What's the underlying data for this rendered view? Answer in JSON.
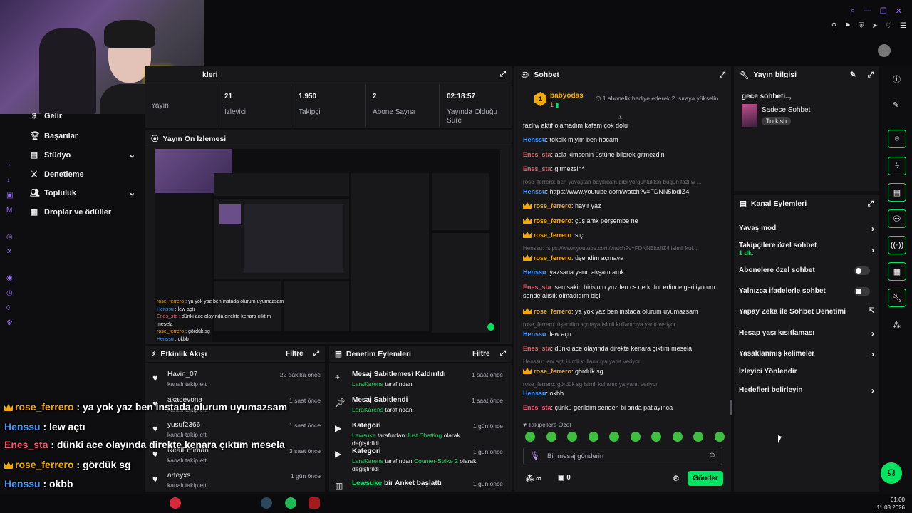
{
  "sidebar": {
    "items": [
      {
        "label": "Gelir",
        "icon": "dollar-icon"
      },
      {
        "label": "Başarılar",
        "icon": "trophy-icon"
      },
      {
        "label": "Stüdyo",
        "icon": "studio-icon",
        "chevron": true
      },
      {
        "label": "Denetleme",
        "icon": "sword-icon"
      },
      {
        "label": "Topluluk",
        "icon": "users-icon",
        "chevron": true
      },
      {
        "label": "Droplar ve ödüller",
        "icon": "gift-icon"
      }
    ]
  },
  "stats": {
    "header_label": "kleri",
    "items": [
      {
        "value": "",
        "label": "Yayın"
      },
      {
        "value": "21",
        "label": "İzleyici"
      },
      {
        "value": "1.950",
        "label": "Takipçi"
      },
      {
        "value": "2",
        "label": "Abone Sayısı"
      },
      {
        "value": "02:18:57",
        "label": "Yayında Olduğu Süre"
      }
    ]
  },
  "preview": {
    "title": "Yayın Ön İzlemesi"
  },
  "activity": {
    "title": "Etkinlik Akışı",
    "filter": "Filtre",
    "items": [
      {
        "name": "Havin_07",
        "sub": "kanalı takip etti",
        "time": "22 dakika önce"
      },
      {
        "name": "akadevona",
        "sub": "kanalı takip etti",
        "time": "1 saat önce"
      },
      {
        "name": "yusuf2366",
        "sub": "kanalı takip etti",
        "time": "1 saat önce"
      },
      {
        "name": "RealEmirhan",
        "sub": "kanalı takip etti",
        "time": "3 saat önce"
      },
      {
        "name": "arteyxs",
        "sub": "kanalı takip etti",
        "time": "1 gün önce"
      }
    ]
  },
  "moderation": {
    "title": "Denetim Eylemleri",
    "filter": "Filtre",
    "items": [
      {
        "title": "Mesaj Sabitlemesi Kaldırıldı",
        "user": "LaraKarens",
        "rest": "tarafından",
        "time": "1 saat önce"
      },
      {
        "title": "Mesaj Sabitlendi",
        "user": "LaraKarens",
        "rest": "tarafından",
        "time": "1 saat önce"
      },
      {
        "title": "Kategori",
        "user": "Lewsuke",
        "rest": "tarafından",
        "cat": "Just Chatting",
        "rest2": "olarak değiştirildi",
        "time": "1 gün önce"
      },
      {
        "title": "Kategori",
        "user": "LaraKarens",
        "rest": "tarafından",
        "cat": "Counter-Strike 2",
        "rest2": "olarak değiştirildi",
        "time": "1 gün önce"
      },
      {
        "title": "bir Anket başlattı",
        "user": "Lewsuke",
        "time": "1 gün önce"
      }
    ]
  },
  "chat": {
    "title": "Sohbet",
    "pinned_user": "babyodas",
    "pinned_count": "1",
    "pinned_text": "1 abonelik hediye ederek 2. sıraya yükselin",
    "followers_only": "Takipçilere Özel",
    "input_placeholder": "Bir mesaj gönderin",
    "send": "Gönder",
    "points": "∞",
    "bits": "0",
    "messages": [
      {
        "user": "",
        "text": "fazlıw aktif olamadım kafam çok dolu",
        "color": "#efeff1"
      },
      {
        "user": "Henssu",
        "text": "toksik miyim ben hocam",
        "color": "#3b9aff"
      },
      {
        "user": "Enes_sta",
        "text": "asla kimsenin üstüne bilerek gitmezdin",
        "color": "#f0576a"
      },
      {
        "user": "Enes_sta",
        "text": "gitmezsin*",
        "color": "#f0576a"
      },
      {
        "reply": "rose_ferrero: ben yavaştan bayılıcam gibi yorguhluktsn bugün fazlıw ..."
      },
      {
        "user": "Henssu",
        "text": "https://www.youtube.com/watch?v=FDNN5lodIZ4",
        "color": "#3b9aff",
        "link": true
      },
      {
        "user": "rose_ferrero",
        "text": "hayır yaz",
        "color": "#f2a80b",
        "crown": true
      },
      {
        "user": "rose_ferrero",
        "text": "çüş amk perşembe ne",
        "color": "#f2a80b",
        "crown": true
      },
      {
        "user": "rose_ferrero",
        "text": "sıç",
        "color": "#f2a80b",
        "crown": true
      },
      {
        "reply": "Henssu: https://www.youtube.com/watch?v=FDNN5lodIZ4 isimli kul..."
      },
      {
        "user": "rose_ferrero",
        "text": "üşendim açmaya",
        "color": "#f2a80b",
        "crown": true
      },
      {
        "user": "Henssu",
        "text": "yazsana yarın akşam amk",
        "color": "#3b9aff"
      },
      {
        "user": "Enes_sta",
        "text": "sen sakin birisin o yuzden cs de kufur edince geriliyorum sende alısık olmadıgım bişi",
        "color": "#f0576a"
      },
      {
        "user": "rose_ferrero",
        "text": "ya yok yaz ben instada olurum uyumazsam",
        "color": "#f2a80b",
        "crown": true
      },
      {
        "reply": "rose_ferrero: üşendim açmaya isimli kullanıcıya yanıt veriyor"
      },
      {
        "user": "Henssu",
        "text": "lew açtı",
        "color": "#3b9aff"
      },
      {
        "user": "Enes_sta",
        "text": "dünki ace olayında direkte kenara çıktım mesela",
        "color": "#f0576a"
      },
      {
        "reply": "Henssu: lew açtı isimli kullanıcıya yanıt veriyor"
      },
      {
        "user": "rose_ferrero",
        "text": "gördük sg",
        "color": "#f2a80b",
        "crown": true
      },
      {
        "reply": "rose_ferrero: gördük sg isimli kullanıcıya yanıt veriyor"
      },
      {
        "user": "Henssu",
        "text": "okbb",
        "color": "#3b9aff"
      },
      {
        "user": "Enes_sta",
        "text": "çünkü gerildim senden bi anda patlayınca",
        "color": "#f0576a"
      }
    ]
  },
  "stream_info": {
    "title": "Yayın bilgisi",
    "stream_title": "gece sohbeti..,",
    "category": "Sadece Sohbet",
    "language": "Turkish"
  },
  "channel_actions": {
    "title": "Kanal Eylemleri",
    "items": [
      {
        "label": "Yavaş mod",
        "type": "chevron"
      },
      {
        "label": "Takipçilere özel sohbet",
        "sub": "1 dk.",
        "type": "chevron"
      },
      {
        "label": "Abonelere özel sohbet",
        "type": "toggle"
      },
      {
        "label": "Yalnızca ifadelerle sohbet",
        "type": "toggle"
      },
      {
        "label": "Yapay Zeka ile Sohbet Denetimi",
        "type": "external"
      },
      {
        "label": "Hesap yaşı kısıtlaması",
        "type": "chevron"
      },
      {
        "label": "Yasaklanmış kelimeler",
        "type": "chevron"
      },
      {
        "label": "İzleyici Yönlendir",
        "type": "none"
      },
      {
        "label": "Hedefleri belirleyin",
        "type": "chevron"
      }
    ]
  },
  "overlay_chat": [
    {
      "user": "rose_ferrero",
      "text": ": ya yok yaz ben instada olurum uyumazsam",
      "color": "#f2a80b",
      "crown": true
    },
    {
      "user": "Henssu",
      "text": ": lew açtı",
      "color": "#3b9aff"
    },
    {
      "user": "Enes_sta",
      "text": ": dünki ace olayında direkte kenara çıktım mesela",
      "color": "#f0576a"
    },
    {
      "user": "rose_ferrero",
      "text": ": gördük sg",
      "color": "#f2a80b",
      "crown": true
    },
    {
      "user": "Henssu",
      "text": ": okbb",
      "color": "#3b9aff"
    },
    {
      "user": "Enes_sta",
      "text": ": çünkü gerildim senden bi anda patlayınca",
      "color": "#f0576a"
    }
  ],
  "taskbar": {
    "time": "01:00",
    "date": "11.03.2026"
  },
  "colors": {
    "accent": "#00e561",
    "panel": "#18181b",
    "bg": "#0e0e10"
  }
}
